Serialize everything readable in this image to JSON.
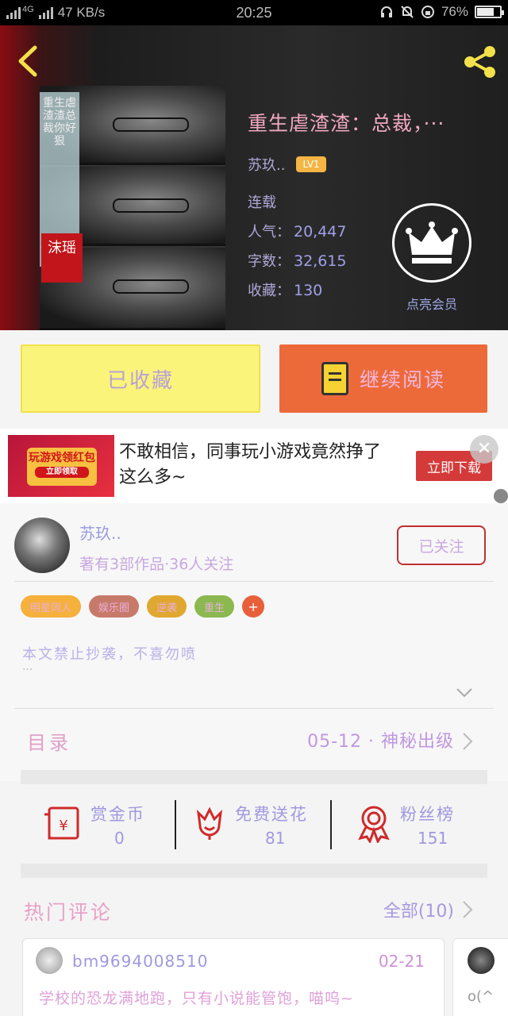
{
  "status_bar": {
    "network": "4G",
    "speed": "47 KB/s",
    "time": "20:25",
    "battery": "76%",
    "battery_level": 0.76
  },
  "book": {
    "title": "重生虐渣渣：总裁，···",
    "author": "苏玖..",
    "level": "LV1",
    "status": "连载",
    "popularity_label": "人气：",
    "popularity": "20,447",
    "words_label": "字数：",
    "words": "32,615",
    "collections_label": "收藏：",
    "collections": "130",
    "vip_label": "点亮会员",
    "cover_strip": "重生虐渣渣总裁你好狠",
    "cover_seal": "沫瑶"
  },
  "actions": {
    "collected_label": "已收藏",
    "continue_label": "继续阅读"
  },
  "ad": {
    "text": "不敢相信，同事玩小游戏竟然挣了这么多~",
    "button": "立即下载",
    "close": "✕",
    "image_text": "玩游戏领红包",
    "image_sub": "立即领取"
  },
  "author_section": {
    "name": "苏玖..",
    "subtitle": "著有3部作品·36人关注",
    "follow_label": "已关注",
    "tags": [
      {
        "label": "明星同人",
        "color": "#f6b03c"
      },
      {
        "label": "娱乐圈",
        "color": "#c87a6a"
      },
      {
        "label": "逆袭",
        "color": "#e0a830"
      },
      {
        "label": "重生",
        "color": "#8cb850"
      }
    ],
    "tag_more": "+",
    "description": "本文禁止抄袭，不喜勿喷",
    "description_more": "···"
  },
  "catalog": {
    "label": "目录",
    "update": "05-12 · 神秘出级"
  },
  "rewards": [
    {
      "label": "赏金币",
      "value": "0",
      "icon": "envelope-yen-icon"
    },
    {
      "label": "免费送花",
      "value": "81",
      "icon": "flower-icon"
    },
    {
      "label": "粉丝榜",
      "value": "151",
      "icon": "medal-icon"
    }
  ],
  "comments": {
    "label": "热门评论",
    "all": "全部(10)",
    "items": [
      {
        "user": "bm9694008510",
        "date": "02-21",
        "text": "学校的恐龙满地跑，只有小说能管饱，喵呜~"
      },
      {
        "text": "o(^"
      }
    ]
  },
  "colors": {
    "collected_bg": "#fbf47a",
    "read_bg": "#ec6a3a",
    "follow_border": "#c03030",
    "icon_red": "#d02a2a"
  }
}
